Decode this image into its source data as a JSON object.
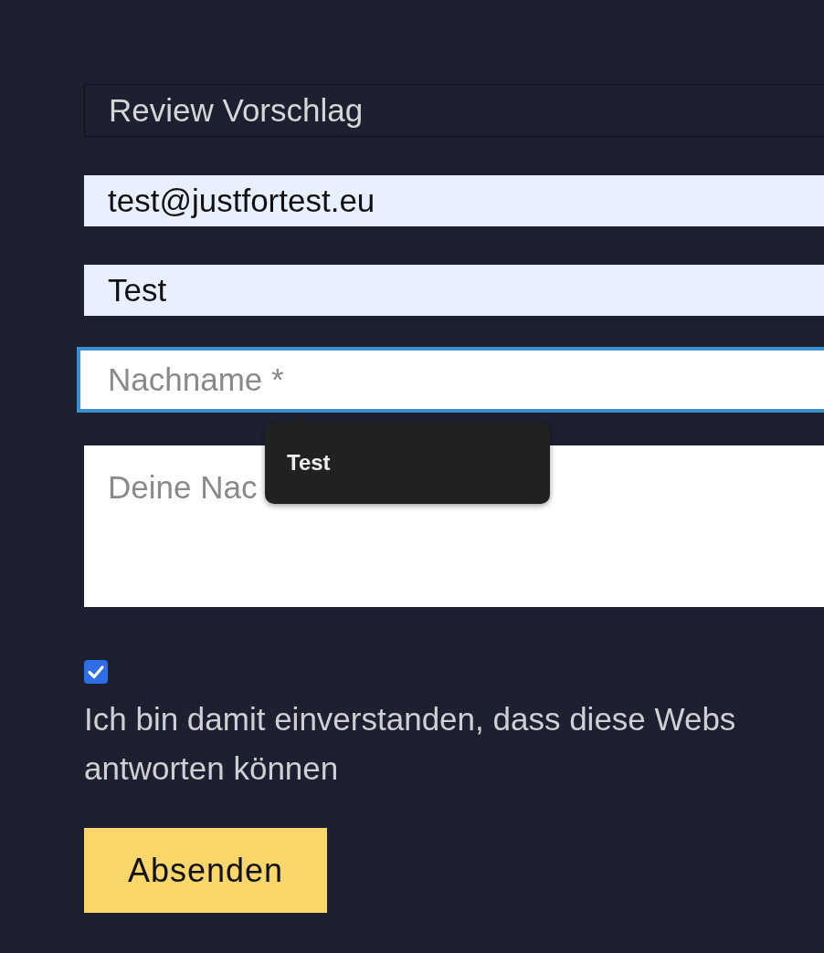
{
  "subject_field": {
    "value": "Review Vorschlag"
  },
  "email_field": {
    "value": "test@justfortest.eu",
    "autofilled": true
  },
  "first_name_field": {
    "value": "Test",
    "autofilled": true
  },
  "last_name_field": {
    "placeholder": "Nachname *",
    "focused": true
  },
  "message_field": {
    "placeholder": "Deine Nac"
  },
  "tooltip": {
    "text": "Test"
  },
  "consent": {
    "checked": true,
    "text": "Ich bin damit einverstanden, dass diese Webs\nantworten können"
  },
  "submit_button": {
    "label": "Absenden"
  }
}
